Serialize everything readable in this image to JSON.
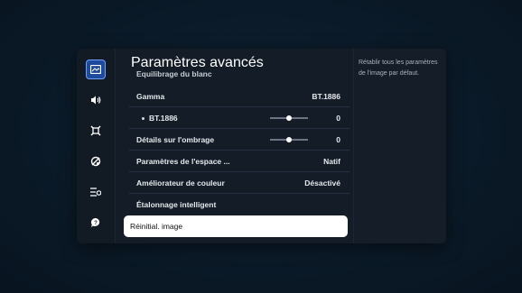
{
  "sidebar": {
    "icons": [
      "picture-icon",
      "sound-icon",
      "connection-icon",
      "support-icon",
      "general-icon",
      "help-icon"
    ]
  },
  "main": {
    "title": "Paramètres avancés",
    "cut_row": "Équilibrage du blanc",
    "rows": [
      {
        "label": "Gamma",
        "value": "BT.1886"
      },
      {
        "label": "BT.1886",
        "value": "0",
        "slider": 0.5
      },
      {
        "label": "Détails sur l'ombrage",
        "value": "0",
        "slider": 0.5
      },
      {
        "label": "Paramètres de l'espace ...",
        "value": "Natif"
      },
      {
        "label": "Améliorateur de couleur",
        "value": "Désactivé"
      },
      {
        "label": "Étalonnage intelligent",
        "value": ""
      },
      {
        "label": "Réinitial. image",
        "value": ""
      }
    ]
  },
  "info": {
    "text": "Rétablir tous les paramètres de l'image par défaut."
  },
  "colors": {
    "accent": "#1e4a9c",
    "panel": "#131c27"
  }
}
